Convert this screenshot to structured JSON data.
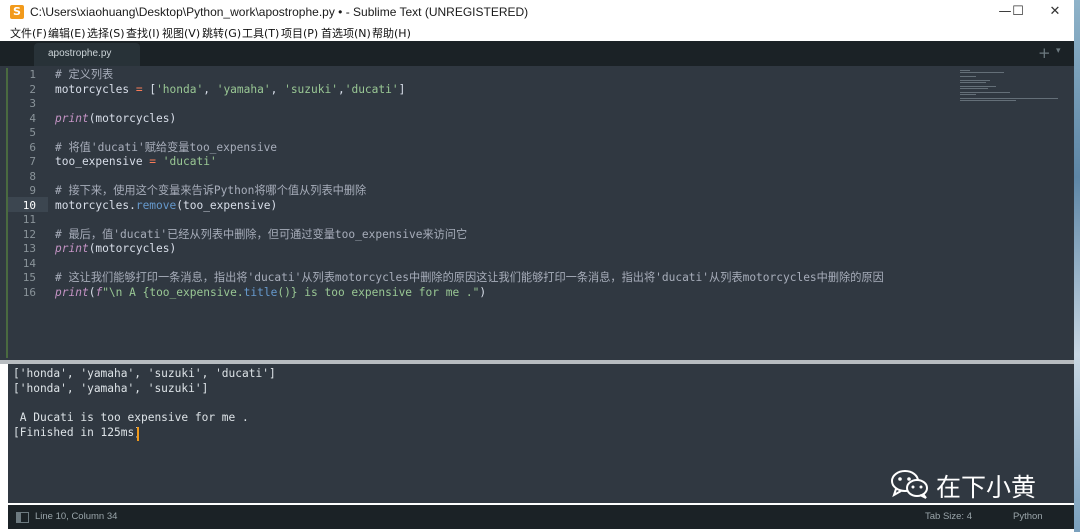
{
  "window": {
    "title": "C:\\Users\\xiaohuang\\Desktop\\Python_work\\apostrophe.py • - Sublime Text (UNREGISTERED)",
    "app_icon": "S",
    "controls": {
      "minimize": "—",
      "maximize": "☐",
      "close": "✕"
    }
  },
  "menu": [
    "文件(F)",
    "编辑(E)",
    "选择(S)",
    "查找(I)",
    "视图(V)",
    "跳转(G)",
    "工具(T)",
    "项目(P)",
    "首选项(N)",
    "帮助(H)"
  ],
  "tabs": {
    "active": "apostrophe.py",
    "add": "+",
    "list": "▾"
  },
  "editor": {
    "current_line": "10",
    "line_numbers": [
      "1",
      "2",
      "3",
      "4",
      "5",
      "6",
      "7",
      "8",
      "9",
      "10",
      "11",
      "12",
      "13",
      "14",
      "15",
      "16"
    ],
    "lines": {
      "l1": "# 定义列表",
      "l2_a": "motorcycles ",
      "l2_b": "=",
      "l2_c": " [",
      "l2_d": "'honda'",
      "l2_e": ", ",
      "l2_f": "'yamaha'",
      "l2_g": ", ",
      "l2_h": "'suzuki'",
      "l2_i": ",",
      "l2_j": "'ducati'",
      "l2_k": "]",
      "l4_a": "print",
      "l4_b": "(motorcycles)",
      "l6": "# 将值'ducati'赋给变量too_expensive",
      "l7_a": "too_expensive ",
      "l7_b": "=",
      "l7_c": " ",
      "l7_d": "'ducati'",
      "l9": "# 接下来，使用这个变量来告诉Python将哪个值从列表中删除",
      "l10_a": "motorcycles.",
      "l10_b": "remove",
      "l10_c": "(too_expensive)",
      "l12": "# 最后，值'ducati'已经从列表中删除，但可通过变量too_expensive来访问它",
      "l13_a": "print",
      "l13_b": "(motorcycles)",
      "l15": "# 这让我们能够打印一条消息，指出将'ducati'从列表motorcycles中删除的原因这让我们能够打印一条消息，指出将'ducati'从列表motorcycles中删除的原因",
      "l16_a": "print",
      "l16_b": "(",
      "l16_c": "f",
      "l16_d": "\"\\n A {too_expensive.",
      "l16_e": "title",
      "l16_f": "()} is too expensive for me .\"",
      "l16_g": ")"
    }
  },
  "output": {
    "lines": [
      "['honda', 'yamaha', 'suzuki', 'ducati']",
      "['honda', 'yamaha', 'suzuki']",
      "",
      " A Ducati is too expensive for me .",
      "[Finished in 125ms]"
    ]
  },
  "watermark": {
    "text": "在下小黄",
    "icon": "wechat-icon"
  },
  "status": {
    "position": "Line 10, Column 34",
    "tab_size": "Tab Size: 4",
    "syntax": "Python"
  },
  "colors": {
    "editor_bg": "#303841",
    "comment": "#a7adba",
    "string": "#99c794",
    "operator": "#f97b58",
    "keyword": "#c594c5",
    "function": "#6699cc"
  }
}
